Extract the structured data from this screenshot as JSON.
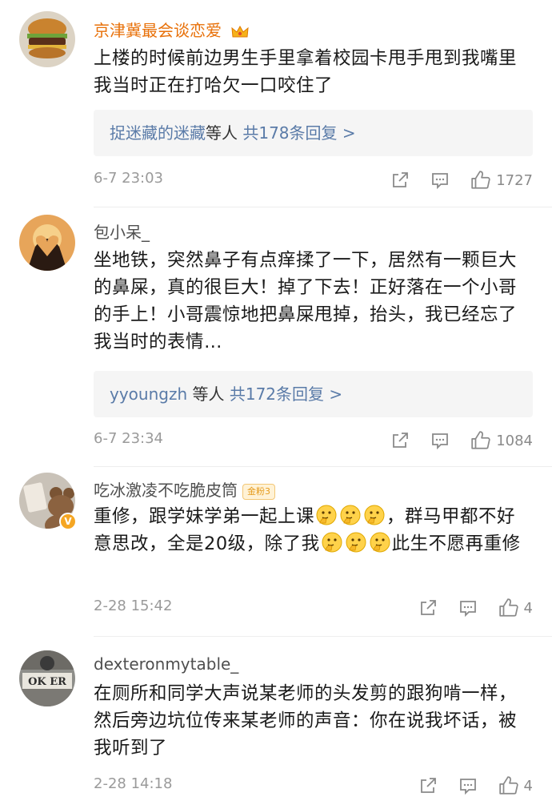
{
  "comments": [
    {
      "username": "京津冀最会谈恋爱",
      "avatar_icon": "burger-avatar",
      "badge_icon": "crown-icon",
      "body": "上楼的时候前边男生手里拿着校园卡甩手甩到我嘴里 我当时正在打哈欠一口咬住了",
      "reply": {
        "link": "捉迷藏的迷藏",
        "mid": "等人",
        "count": "共178条回复 >"
      },
      "time": "6-7 23:03",
      "likes": "1727"
    },
    {
      "username": "包小呆_",
      "avatar_icon": "heart-hands-avatar",
      "body": "坐地铁，突然鼻子有点痒揉了一下，居然有一颗巨大的鼻屎，真的很巨大！掉了下去！正好落在一个小哥的手上！小哥震惊地把鼻屎甩掉，抬头，我已经忘了我当时的表情…",
      "reply": {
        "link": "yyoungzh",
        "mid": "等人",
        "count": "共172条回复 >"
      },
      "time": "6-7 23:34",
      "likes": "1084"
    },
    {
      "username": "吃冰激凌不吃脆皮筒",
      "avatar_icon": "teddy-bear-avatar",
      "fan_badge": "金粉3",
      "body_parts": [
        "重修，跟学妹学弟一起上课",
        "，群马甲都不好意思改，全是20级，除了我",
        "此生不愿再重修"
      ],
      "emoji_name": "thinking-face-emoji",
      "time": "2-28 15:42",
      "likes": "4"
    },
    {
      "username": "dexteronmytable_",
      "avatar_icon": "okcer-avatar",
      "avatar_text": "OK ER",
      "body": "在厕所和同学大声说某老师的头发剪的跟狗啃一样，然后旁边坑位传来某老师的声音：你在说我坏话，被我听到了",
      "time": "2-28 14:18",
      "likes": "4"
    }
  ],
  "icons": {
    "share": "share-icon",
    "comment": "comment-icon",
    "like": "thumbs-up-icon"
  },
  "colors": {
    "accent_orange": "#e8710a",
    "link_blue": "#5a7ba8",
    "reply_bg": "#f5f5f5",
    "meta_gray": "#9a9a9a"
  }
}
